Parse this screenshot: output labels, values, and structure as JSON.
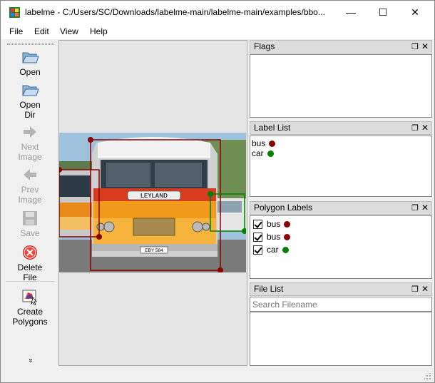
{
  "window": {
    "title": "labelme - C:/Users/SC/Downloads/labelme-main/labelme-main/examples/bbo...",
    "minimize_glyph": "—",
    "maximize_glyph": "☐",
    "close_glyph": "✕"
  },
  "menu": {
    "items": [
      {
        "label": "File"
      },
      {
        "label": "Edit"
      },
      {
        "label": "View"
      },
      {
        "label": "Help"
      }
    ]
  },
  "toolbar": {
    "open": {
      "line1": "Open",
      "icon": "folder-icon"
    },
    "open_dir": {
      "line1": "Open",
      "line2": "Dir",
      "icon": "folder-icon"
    },
    "next_image": {
      "line1": "Next",
      "line2": "Image",
      "icon": "arrow-right-icon",
      "enabled": false
    },
    "prev_image": {
      "line1": "Prev",
      "line2": "Image",
      "icon": "arrow-left-icon",
      "enabled": false
    },
    "save": {
      "line1": "Save",
      "icon": "floppy-icon",
      "enabled": false
    },
    "delete_file": {
      "line1": "Delete",
      "line2": "File",
      "icon": "delete-circle-icon"
    },
    "create_polygons": {
      "line1": "Create",
      "line2": "Polygons",
      "icon": "polygon-icon"
    },
    "expand_glyph": "»"
  },
  "panels": {
    "flags": {
      "title": "Flags"
    },
    "label_list": {
      "title": "Label List",
      "items": [
        {
          "label": "bus",
          "color": "#8b0000"
        },
        {
          "label": "car",
          "color": "#008000"
        }
      ]
    },
    "polygon_labels": {
      "title": "Polygon Labels",
      "items": [
        {
          "label": "bus",
          "color": "#8b0000",
          "checked": true
        },
        {
          "label": "bus",
          "color": "#8b0000",
          "checked": true
        },
        {
          "label": "car",
          "color": "#008000",
          "checked": true
        }
      ]
    },
    "file_list": {
      "title": "File List",
      "search_placeholder": "Search Filename"
    }
  },
  "photo_text": {
    "plate": "EBY 584",
    "brand": "LEYLAND"
  },
  "colors": {
    "bus_box": "#8b0000",
    "car_box": "#008000"
  }
}
